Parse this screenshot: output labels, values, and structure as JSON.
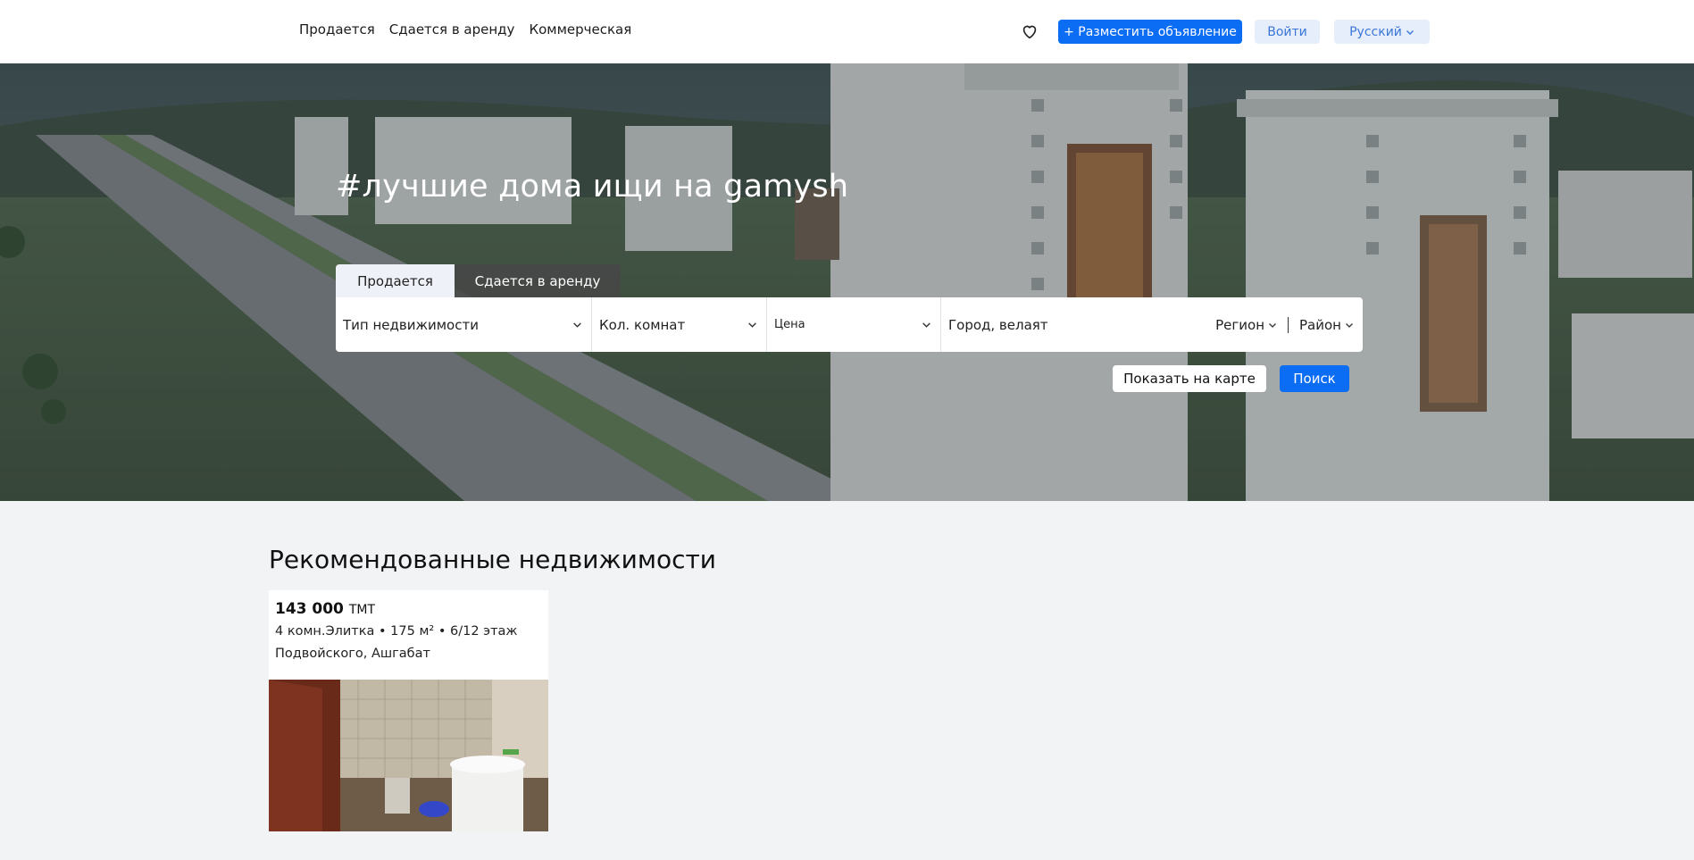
{
  "header": {
    "nav": [
      "Продается",
      "Сдается в аренду",
      "Коммерческая"
    ],
    "favorites_icon": "heart-icon",
    "post_ad_label": "+ Разместить объявление",
    "login_label": "Войти",
    "language_label": "Русский",
    "accent_color": "#0b6cf4"
  },
  "hero": {
    "title": "#лучшие дома ищи на gamysh",
    "tabs": [
      "Продается",
      "Сдается в аренду"
    ],
    "active_tab": "Продается",
    "filters": {
      "property_type": "Тип недвижимости",
      "rooms": "Кол. комнат",
      "price": "Цена",
      "city_placeholder": "Город, велаят",
      "region": "Регион",
      "district": "Район"
    },
    "show_on_map_label": "Показать на карте",
    "search_label": "Поиск"
  },
  "recommended": {
    "title": "Рекомендованные недвижимости",
    "listings": [
      {
        "price": "143 000",
        "currency": "ТМТ",
        "details": "4 комн.Элитка • 175 м² • 6/12 этаж",
        "address": "Подвойского, Ашгабат"
      }
    ]
  }
}
